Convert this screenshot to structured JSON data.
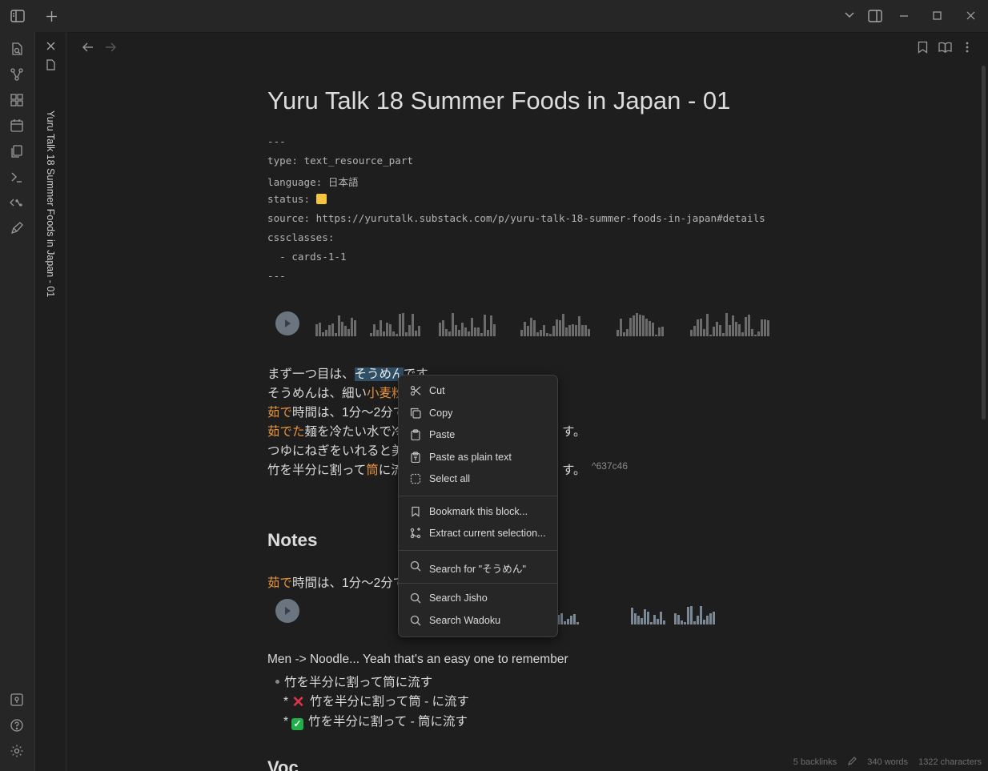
{
  "titlebar": {
    "icons": [
      "sidebar-toggle-icon",
      "new-tab-icon",
      "chevron-down-icon",
      "right-sidebar-icon",
      "minimize-icon",
      "maximize-icon",
      "close-icon"
    ]
  },
  "ribbon": {
    "top_icons": [
      "open-quick-switcher-icon",
      "graph-view-icon",
      "canvas-icon",
      "daily-note-icon",
      "templates-icon",
      "command-palette-icon",
      "templater-icon",
      "excalidraw-icon"
    ],
    "bottom_icons": [
      "vault-switcher-icon",
      "help-icon",
      "settings-icon"
    ]
  },
  "tab": {
    "title": "Yuru Talk 18 Summer Foods in Japan - 01"
  },
  "note": {
    "title": "Yuru Talk 18 Summer Foods in Japan - 01",
    "frontmatter": {
      "open": "---",
      "type_key": "type:",
      "type_val": "text_resource_part",
      "language_key": "language:",
      "language_val": "日本語",
      "status_key": "status:",
      "source_key": "source:",
      "source_val": "https://yurutalk.substack.com/p/yuru-talk-18-summer-foods-in-japan#details",
      "cssclasses_key": "cssclasses:",
      "cssclasses_item": "  - cards-1-1",
      "close": "---"
    },
    "lines": {
      "l1_a": "まず一つ目は、",
      "l1_sel": "そうめん",
      "l1_b": "です。",
      "l2_a": "そうめんは、細い",
      "l2_orange": "小麦粉",
      "l3_orange": "茹で",
      "l3_b": "時間は、1分〜2分で",
      "l4_orange": "茹でた",
      "l4_b": "麺を冷たい水で冷",
      "l4_tail": "す。",
      "l5_a": "つゆにねぎをいれると美",
      "l6_a": "竹を半分に割って",
      "l6_orange": "筒",
      "l6_b": "に流",
      "l6_tail": "す。",
      "block_id": "^637c46"
    },
    "notes_heading": "Notes",
    "notes_line_orange": "茹で",
    "notes_line_b": "時間は、1分〜2分で",
    "men_line": "Men -> Noodle... Yeah that's an easy one to remember",
    "bullet1": "竹を半分に割って筒に流す",
    "wrong_marker": "*",
    "wrong_text": "竹を半分に割って筒 - に流す",
    "right_marker": "*",
    "right_text": "竹を半分に割って - 筒に流す",
    "next_heading_fragment": "Voc"
  },
  "status_bar": {
    "backlinks": "5 backlinks",
    "words": "340 words",
    "characters": "1322 characters"
  },
  "context_menu": {
    "items": [
      {
        "label": "Cut",
        "icon": "scissors-icon"
      },
      {
        "label": "Copy",
        "icon": "copy-icon"
      },
      {
        "label": "Paste",
        "icon": "clipboard-icon"
      },
      {
        "label": "Paste as plain text",
        "icon": "clipboard-text-icon"
      },
      {
        "label": "Select all",
        "icon": "select-all-icon"
      },
      {
        "label": "Bookmark this block...",
        "icon": "bookmark-icon"
      },
      {
        "label": "Extract current selection...",
        "icon": "extract-icon"
      },
      {
        "label": "Search for \"そうめん\"",
        "icon": "search-icon"
      },
      {
        "label": "Search Jisho",
        "icon": "search-icon"
      },
      {
        "label": "Search Wadoku",
        "icon": "search-icon"
      }
    ]
  },
  "colors": {
    "background": "#1e1e1e",
    "accent_orange": "#e8933c",
    "selection": "#2e4f66",
    "status_yellow": "#f5c542"
  }
}
